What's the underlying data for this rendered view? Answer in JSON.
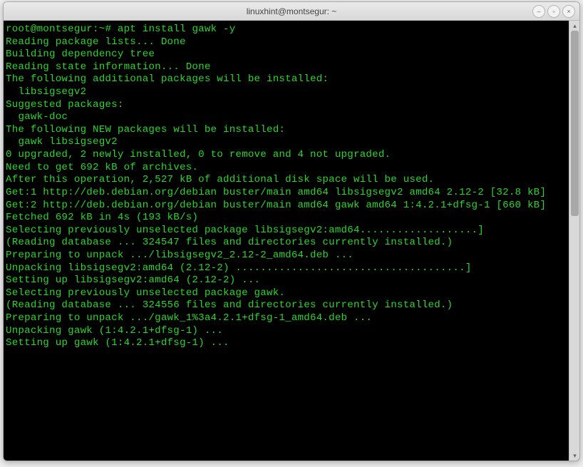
{
  "window": {
    "title": "linuxhint@montsegur: ~"
  },
  "prompt": {
    "user_host": "root@montsegur",
    "path": "~",
    "symbol": "#",
    "command": "apt install gawk -y"
  },
  "output": [
    "Reading package lists... Done",
    "Building dependency tree",
    "Reading state information... Done",
    "The following additional packages will be installed:",
    "  libsigsegv2",
    "Suggested packages:",
    "  gawk-doc",
    "The following NEW packages will be installed:",
    "  gawk libsigsegv2",
    "0 upgraded, 2 newly installed, 0 to remove and 4 not upgraded.",
    "Need to get 692 kB of archives.",
    "After this operation, 2,527 kB of additional disk space will be used.",
    "Get:1 http://deb.debian.org/debian buster/main amd64 libsigsegv2 amd64 2.12-2 [32.8 kB]",
    "Get:2 http://deb.debian.org/debian buster/main amd64 gawk amd64 1:4.2.1+dfsg-1 [660 kB]",
    "Fetched 692 kB in 4s (193 kB/s)",
    "Selecting previously unselected package libsigsegv2:amd64...................]",
    "(Reading database ... 324547 files and directories currently installed.)",
    "Preparing to unpack .../libsigsegv2_2.12-2_amd64.deb ...",
    "Unpacking libsigsegv2:amd64 (2.12-2) .....................................]",
    "Setting up libsigsegv2:amd64 (2.12-2) ...",
    "Selecting previously unselected package gawk.",
    "(Reading database ... 324556 files and directories currently installed.)",
    "Preparing to unpack .../gawk_1%3a4.2.1+dfsg-1_amd64.deb ...",
    "Unpacking gawk (1:4.2.1+dfsg-1) ...",
    "Setting up gawk (1:4.2.1+dfsg-1) ..."
  ],
  "win_controls": {
    "minimize": "–",
    "maximize": "▫",
    "close": "×"
  }
}
